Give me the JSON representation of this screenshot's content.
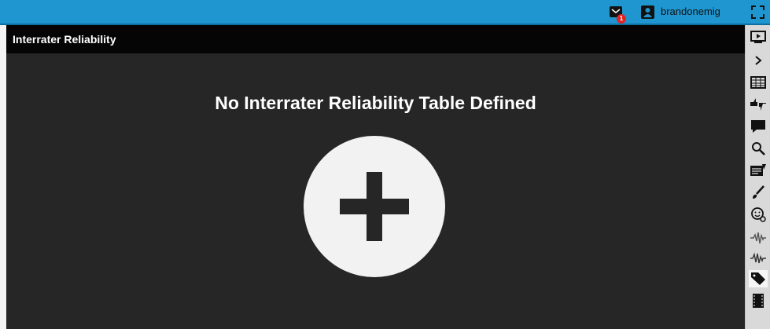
{
  "topbar": {
    "notification_count": "1",
    "username": "brandonemig"
  },
  "panel": {
    "title": "Interrater Reliability",
    "empty_message": "No Interrater Reliability Table Defined"
  },
  "toolbar": {
    "icons": [
      "video-icon",
      "chevron-right-icon",
      "table-icon",
      "thumbs-icon",
      "comment-icon",
      "search-icon",
      "notes-icon",
      "brush-icon",
      "face-icon",
      "waveform-icon",
      "waveform-alt-icon",
      "tag-icon",
      "film-icon"
    ]
  },
  "colors": {
    "topbar": "#1f96cf",
    "header": "#050505",
    "body": "#262626",
    "toolbar": "#d9d9d9",
    "badge": "#e02424"
  }
}
